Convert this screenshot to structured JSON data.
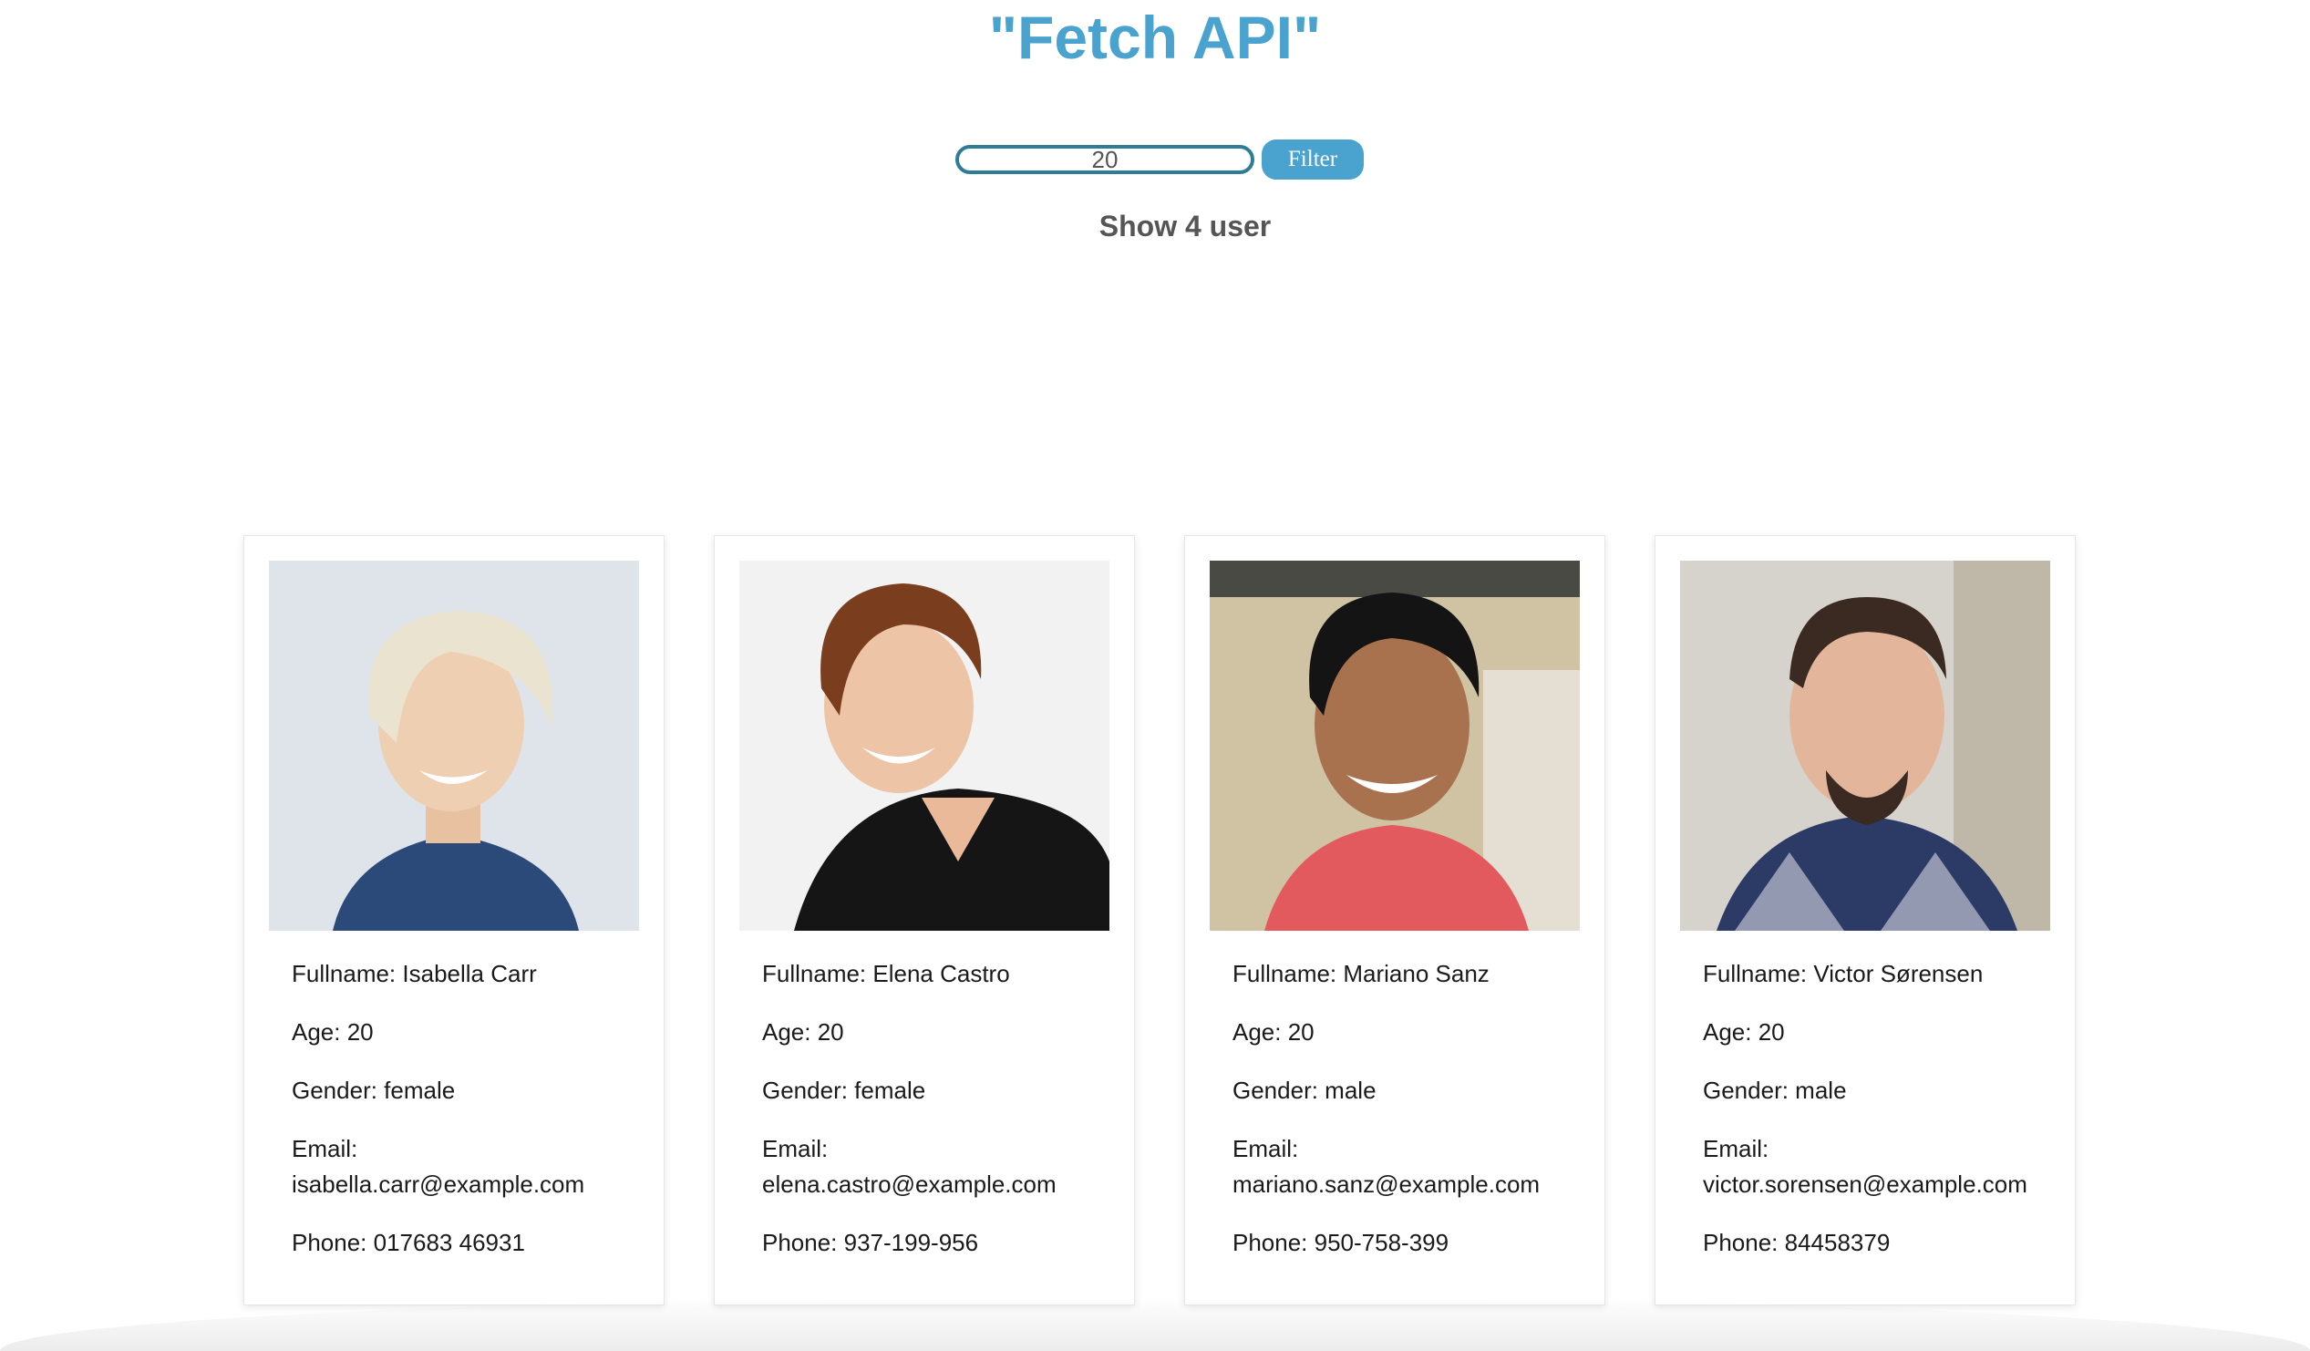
{
  "header": {
    "title": "\"Fetch API\""
  },
  "filter": {
    "value": "20",
    "button_label": "Filter"
  },
  "status": {
    "count_text": "Show 4 user"
  },
  "users": [
    {
      "fullname": "Fullname: Isabella Carr",
      "age": "Age: 20",
      "gender": "Gender: female",
      "email_label": "Email:",
      "email": "isabella.carr@example.com",
      "phone": "Phone: 017683 46931"
    },
    {
      "fullname": "Fullname: Elena Castro",
      "age": "Age: 20",
      "gender": "Gender: female",
      "email_label": "Email:",
      "email": "elena.castro@example.com",
      "phone": "Phone: 937-199-956"
    },
    {
      "fullname": "Fullname: Mariano Sanz",
      "age": "Age: 20",
      "gender": "Gender: male",
      "email_label": "Email:",
      "email": "mariano.sanz@example.com",
      "phone": "Phone: 950-758-399"
    },
    {
      "fullname": "Fullname: Victor Sørensen",
      "age": "Age: 20",
      "gender": "Gender: male",
      "email_label": "Email:",
      "email": "victor.sorensen@example.com",
      "phone": "Phone: 84458379"
    }
  ]
}
